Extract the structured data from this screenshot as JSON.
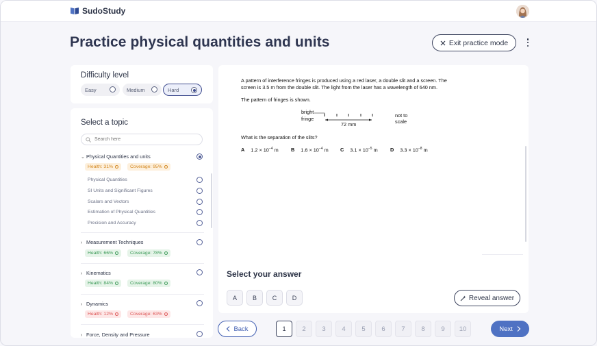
{
  "app": {
    "name": "SudoStudy"
  },
  "page": {
    "title": "Practice physical quantities and units"
  },
  "header": {
    "exit_label": "Exit practice mode"
  },
  "difficulty": {
    "title": "Difficulty level",
    "options": [
      "Easy",
      "Medium",
      "Hard"
    ],
    "selected": "Hard"
  },
  "topics": {
    "title": "Select a topic",
    "search_placeholder": "Search here",
    "items": [
      {
        "label": "Physical Quantities and units",
        "health": "Health: 31%",
        "coverage": "Coverage: 95%",
        "selected": true,
        "expanded": true,
        "subtopics": [
          "Physical Quantities",
          "SI Units and Significant Figures",
          "Scalars and Vectors",
          "Estimation of Physical Quantities",
          "Precision and Accuracy"
        ]
      },
      {
        "label": "Measurement Techniques",
        "health": "Health: 66%",
        "coverage": "Coverage: 78%"
      },
      {
        "label": "Kinematics",
        "health": "Health: 84%",
        "coverage": "Coverage: 80%"
      },
      {
        "label": "Dynamics",
        "health": "Health: 12%",
        "coverage": "Coverage: 63%"
      },
      {
        "label": "Force, Density and Pressure"
      }
    ]
  },
  "question": {
    "line1": "A pattern of interference fringes is produced using a red laser, a double slit and a screen. The",
    "line2": "screen is 3.5 m from the double slit. The light from the laser has a wavelength of 640 nm.",
    "line3": "The pattern of fringes is shown.",
    "fig_bright": "bright",
    "fig_fringe": "fringe",
    "fig_measure": "72 mm",
    "fig_not_to": "not to",
    "fig_scale": "scale",
    "prompt": "What is the separation of the slits?",
    "options": [
      {
        "letter": "A",
        "base": "1.2 × 10",
        "exp": "−4",
        "unit": " m"
      },
      {
        "letter": "B",
        "base": "1.6 × 10",
        "exp": "−4",
        "unit": " m"
      },
      {
        "letter": "C",
        "base": "3.1 × 10",
        "exp": "−5",
        "unit": " m"
      },
      {
        "letter": "D",
        "base": "3.3 × 10",
        "exp": "−8",
        "unit": " m"
      }
    ]
  },
  "answer": {
    "title": "Select your answer",
    "choices": [
      "A",
      "B",
      "C",
      "D"
    ],
    "reveal_label": "Reveal answer"
  },
  "pagination": {
    "back_label": "Back",
    "next_label": "Next",
    "pages": [
      "1",
      "2",
      "3",
      "4",
      "5",
      "6",
      "7",
      "8",
      "9",
      "10"
    ],
    "current": "1"
  }
}
